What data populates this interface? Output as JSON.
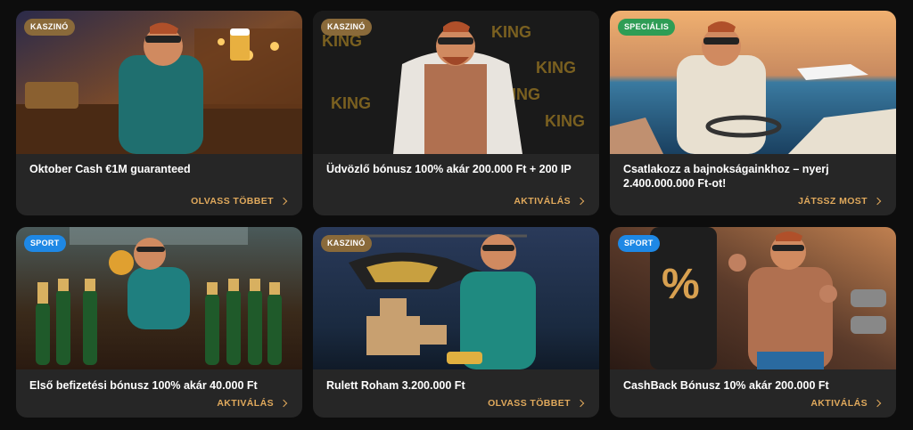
{
  "colors": {
    "card_bg": "#262626",
    "page_bg": "#0d0d0d",
    "cta": "#e0a95c",
    "badge_casino": "#8a6a3a",
    "badge_special": "#2e9d55",
    "badge_sport": "#1e88e5"
  },
  "cards": [
    {
      "badge": "KASZINÓ",
      "title": "Oktober Cash €1M guaranteed",
      "cta": "OLVASS TÖBBET",
      "art": "oktoberfest-beer-scene"
    },
    {
      "badge": "KASZINÓ",
      "title": "Üdvözlő bónusz 100% akár 200.000 Ft + 200 IP",
      "cta": "AKTIVÁLÁS",
      "art": "king-fur-coat-scene",
      "art_text": "KING"
    },
    {
      "badge": "SPECIÁLIS",
      "title": "Csatlakozz a bajnokságainkhoz – nyerj 2.400.000.000 Ft-ot!",
      "cta": "JÁTSSZ MOST",
      "art": "speedboat-sunset-scene"
    },
    {
      "badge": "SPORT",
      "title": "Első befizetési bónusz 100% akár 40.000 Ft",
      "cta": "AKTIVÁLÁS",
      "art": "champagne-bowling-scene"
    },
    {
      "badge": "KASZINÓ",
      "title": "Rulett Roham 3.200.000 Ft",
      "cta": "OLVASS TÖBBET",
      "art": "helicopter-money-scene"
    },
    {
      "badge": "SPORT",
      "title": "CashBack Bónusz 10% akár 200.000 Ft",
      "cta": "AKTIVÁLÁS",
      "art": "boxing-bag-scene",
      "art_text": "%"
    }
  ]
}
